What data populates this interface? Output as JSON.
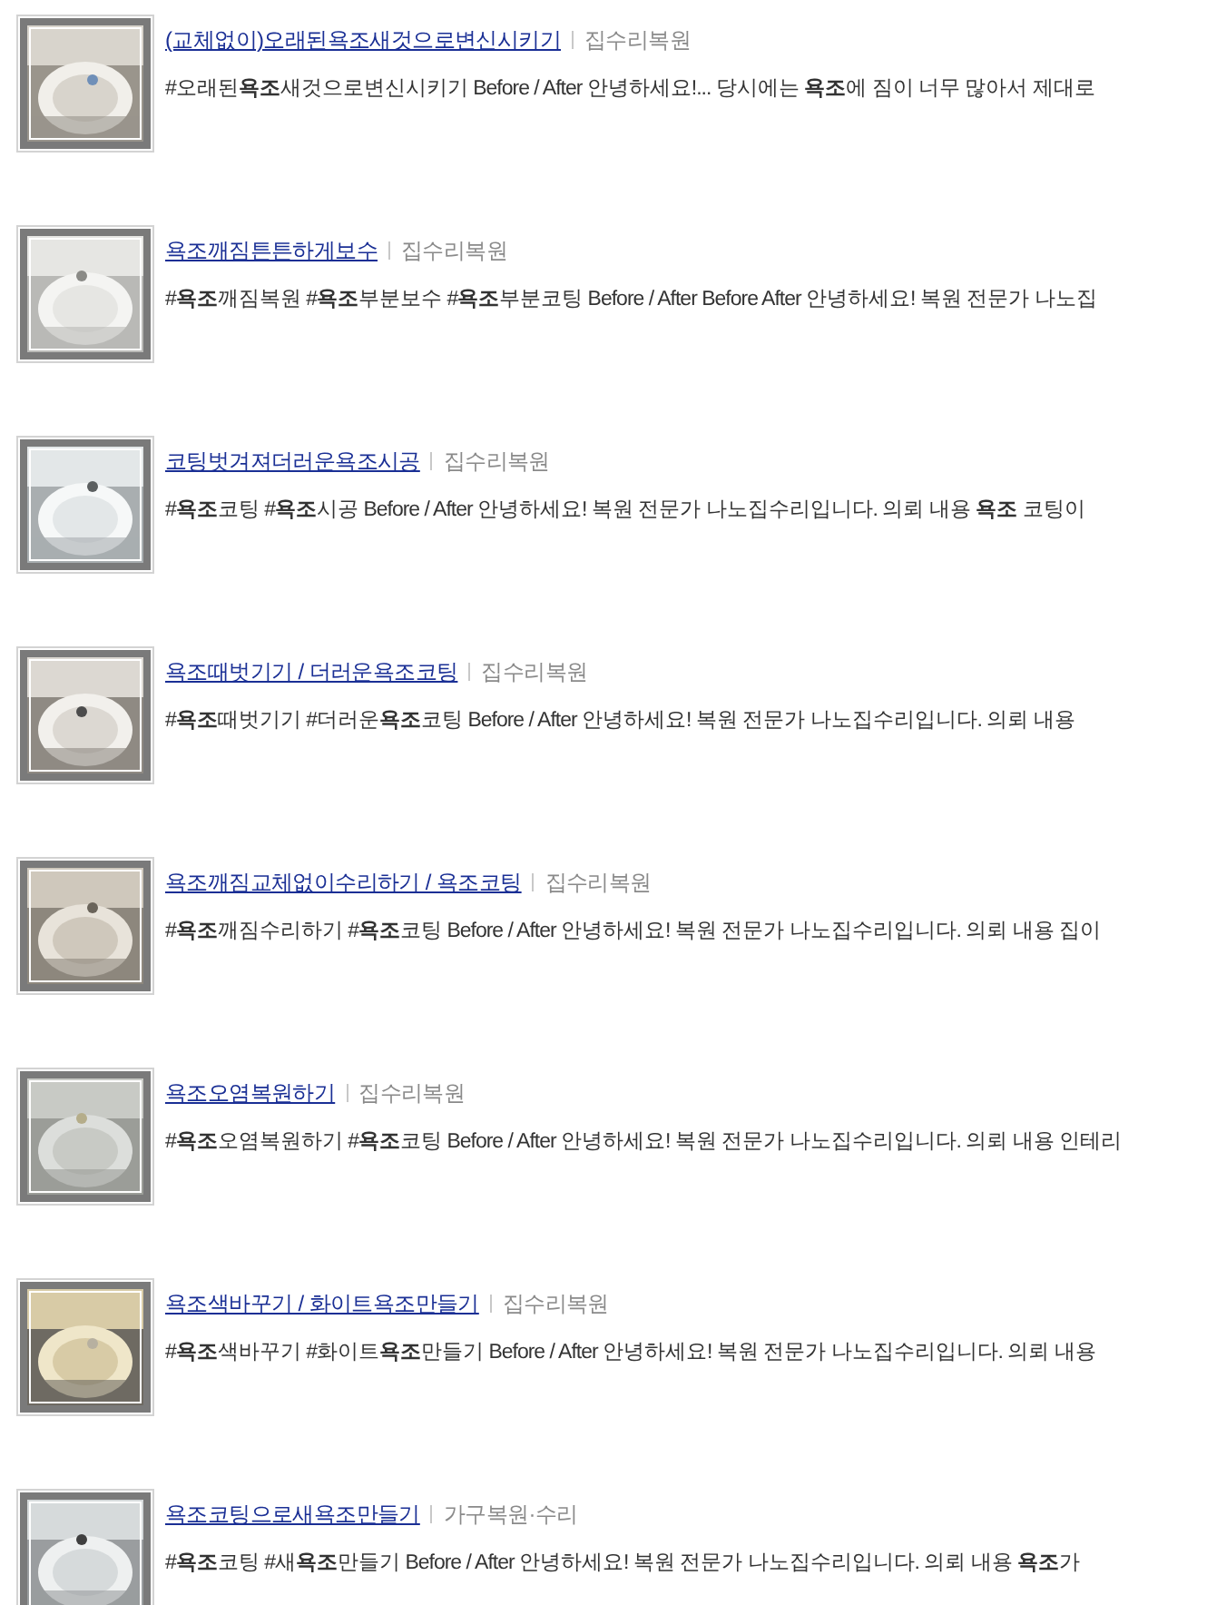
{
  "results": [
    {
      "title": "(교체없이)오래된욕조새것으로변신시키기",
      "category": "집수리복원",
      "snippet": "#오래된**욕조**새것으로변신시키기 Before / After 안녕하세요!... 당시에는 **욕조**에 짐이 너무 많아서 제대로"
    },
    {
      "title": "욕조깨짐튼튼하게보수",
      "category": "집수리복원",
      "snippet": "#**욕조**깨짐복원 #**욕조**부분보수 #**욕조**부분코팅 Before / After Before After 안녕하세요! 복원 전문가 나노집"
    },
    {
      "title": "코팅벗겨져더러운욕조시공",
      "category": "집수리복원",
      "snippet": "#**욕조**코팅 #**욕조**시공 Before / After 안녕하세요! 복원 전문가 나노집수리입니다. 의뢰 내용 **욕조** 코팅이"
    },
    {
      "title": "욕조때벗기기 / 더러운욕조코팅",
      "category": "집수리복원",
      "snippet": "#**욕조**때벗기기 #더러운**욕조**코팅 Before / After 안녕하세요! 복원 전문가 나노집수리입니다. 의뢰 내용"
    },
    {
      "title": "욕조깨짐교체없이수리하기 / 욕조코팅",
      "category": "집수리복원",
      "snippet": "#**욕조**깨짐수리하기 #**욕조**코팅 Before / After 안녕하세요! 복원 전문가 나노집수리입니다. 의뢰 내용 집이"
    },
    {
      "title": "욕조오염복원하기",
      "category": "집수리복원",
      "snippet": "#**욕조**오염복원하기 #**욕조**코팅 Before / After 안녕하세요! 복원 전문가 나노집수리입니다. 의뢰 내용 인테리"
    },
    {
      "title": "욕조색바꾸기 / 화이트욕조만들기",
      "category": "집수리복원",
      "snippet": "#**욕조**색바꾸기 #화이트**욕조**만들기 Before / After 안녕하세요! 복원 전문가 나노집수리입니다. 의뢰 내용"
    },
    {
      "title": "욕조코팅으로새욕조만들기",
      "category": "가구복원·수리",
      "snippet": "#**욕조**코팅 #새**욕조**만들기 Before / After 안녕하세요! 복원 전문가 나노집수리입니다. 의뢰 내용 **욕조**가"
    }
  ]
}
